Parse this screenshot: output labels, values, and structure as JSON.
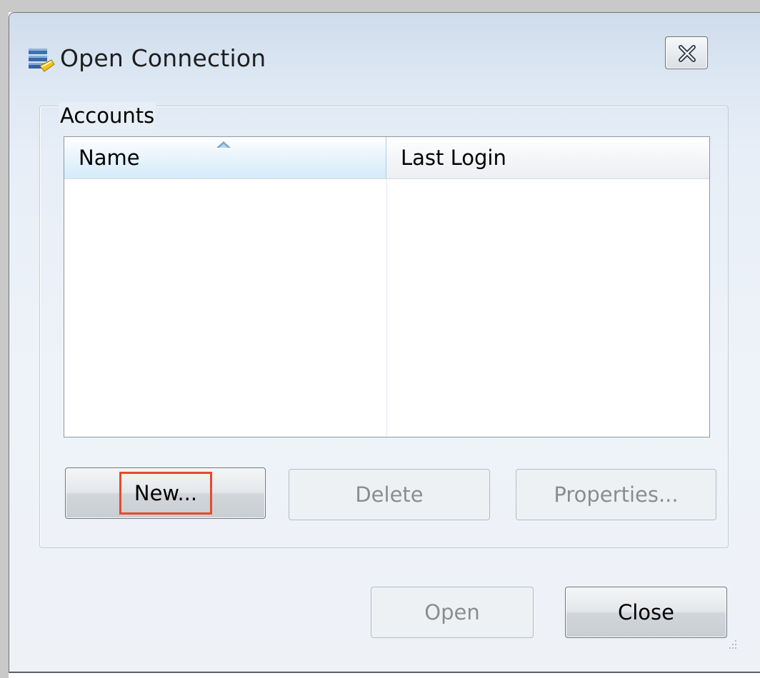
{
  "window": {
    "title": "Open Connection",
    "icon": "database-connection-icon",
    "close_icon": "close-icon"
  },
  "accounts": {
    "label": "Accounts",
    "columns": [
      {
        "label": "Name",
        "sorted": "ascending"
      },
      {
        "label": "Last Login"
      }
    ],
    "rows": []
  },
  "buttons": {
    "new": "New...",
    "delete": "Delete",
    "properties": "Properties...",
    "open": "Open",
    "close": "Close"
  },
  "colors": {
    "highlight": "#e8492b",
    "sorted_header": "#d3ebf8"
  }
}
